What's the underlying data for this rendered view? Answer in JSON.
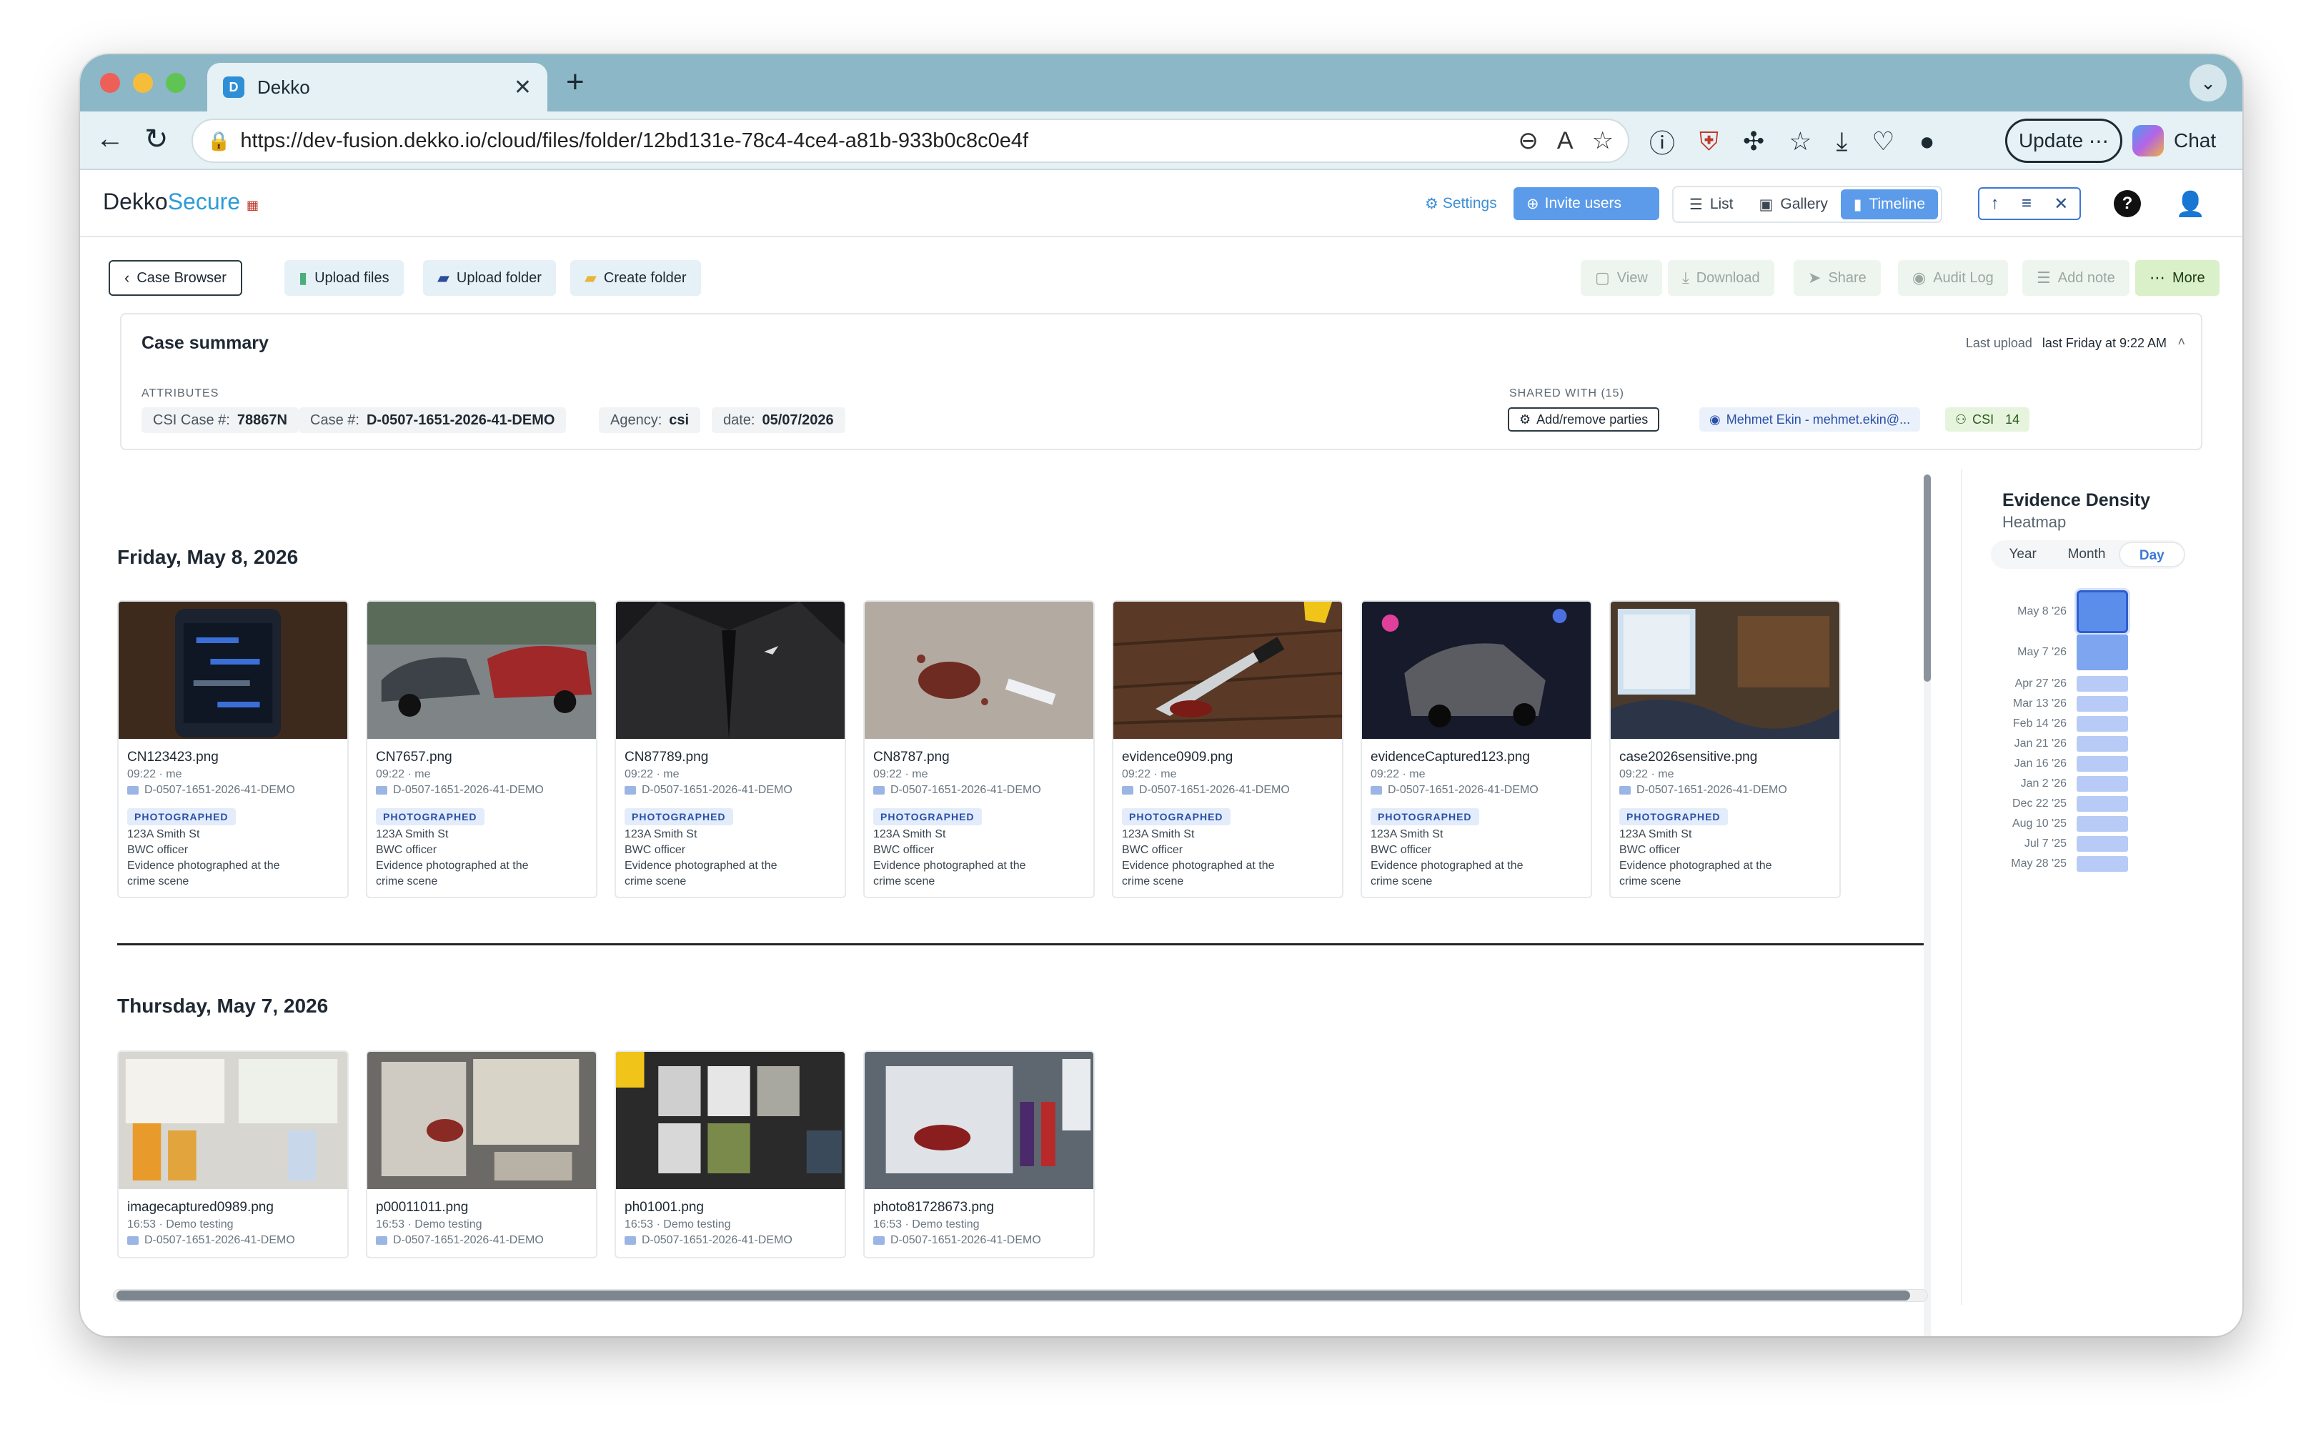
{
  "browser": {
    "tab_title": "Dekko",
    "tab_favicon_letter": "D",
    "url": "https://dev-fusion.dekko.io/cloud/files/folder/12bd131e-78c4-4ce4-a81b-933b0c8c0e4f",
    "update_label": "Update",
    "chat_label": "Chat"
  },
  "app": {
    "logo_a": "Dekko",
    "logo_b": "Secure",
    "settings_label": "Settings",
    "invite_label": "Invite users",
    "views": [
      "List",
      "Gallery",
      "Timeline"
    ],
    "active_view": "Timeline"
  },
  "toolbar": {
    "case_browser": "Case Browser",
    "upload_files": "Upload files",
    "upload_folder": "Upload folder",
    "create_folder": "Create folder",
    "view": "View",
    "download": "Download",
    "share": "Share",
    "audit_log": "Audit Log",
    "add_note": "Add note",
    "more": "More"
  },
  "case_summary": {
    "title": "Case summary",
    "last_upload_label": "Last upload",
    "last_upload_value": "last Friday at 9:22 AM",
    "attributes_label": "ATTRIBUTES",
    "attributes": [
      {
        "key": "CSI Case #:",
        "value": "78867N"
      },
      {
        "key": "Case #:",
        "value": "D-0507-1651-2026-41-DEMO"
      },
      {
        "key": "Agency:",
        "value": "csi"
      },
      {
        "key": "date:",
        "value": "05/07/2026"
      }
    ],
    "shared_label": "SHARED WITH (15)",
    "add_parties": "Add/remove parties",
    "shared_user": "Mehmet Ekin - mehmet.ekin@...",
    "group_name": "CSI",
    "group_count": "14"
  },
  "groups": [
    {
      "date": "Friday, May 8, 2026",
      "items": [
        {
          "name": "CN123423.png",
          "meta": "09:22 · me",
          "path": "D-0507-1651-2026-41-DEMO",
          "badge": "PHOTOGRAPHED",
          "line1": "123A Smith St",
          "line2": "BWC officer",
          "line3": "Evidence photographed at the",
          "line4": "crime scene"
        },
        {
          "name": "CN7657.png",
          "meta": "09:22 · me",
          "path": "D-0507-1651-2026-41-DEMO",
          "badge": "PHOTOGRAPHED",
          "line1": "123A Smith St",
          "line2": "BWC officer",
          "line3": "Evidence photographed at the",
          "line4": "crime scene"
        },
        {
          "name": "CN87789.png",
          "meta": "09:22 · me",
          "path": "D-0507-1651-2026-41-DEMO",
          "badge": "PHOTOGRAPHED",
          "line1": "123A Smith St",
          "line2": "BWC officer",
          "line3": "Evidence photographed at the",
          "line4": "crime scene"
        },
        {
          "name": "CN8787.png",
          "meta": "09:22 · me",
          "path": "D-0507-1651-2026-41-DEMO",
          "badge": "PHOTOGRAPHED",
          "line1": "123A Smith St",
          "line2": "BWC officer",
          "line3": "Evidence photographed at the",
          "line4": "crime scene"
        },
        {
          "name": "evidence0909.png",
          "meta": "09:22 · me",
          "path": "D-0507-1651-2026-41-DEMO",
          "badge": "PHOTOGRAPHED",
          "line1": "123A Smith St",
          "line2": "BWC officer",
          "line3": "Evidence photographed at the",
          "line4": "crime scene"
        },
        {
          "name": "evidenceCaptured123.png",
          "meta": "09:22 · me",
          "path": "D-0507-1651-2026-41-DEMO",
          "badge": "PHOTOGRAPHED",
          "line1": "123A Smith St",
          "line2": "BWC officer",
          "line3": "Evidence photographed at the",
          "line4": "crime scene"
        },
        {
          "name": "case2026sensitive.png",
          "meta": "09:22 · me",
          "path": "D-0507-1651-2026-41-DEMO",
          "badge": "PHOTOGRAPHED",
          "line1": "123A Smith St",
          "line2": "BWC officer",
          "line3": "Evidence photographed at the",
          "line4": "crime scene"
        }
      ]
    },
    {
      "date": "Thursday, May 7, 2026",
      "items": [
        {
          "name": "imagecaptured0989.png",
          "meta": "16:53 · Demo testing",
          "path": "D-0507-1651-2026-41-DEMO"
        },
        {
          "name": "p00011011.png",
          "meta": "16:53 · Demo testing",
          "path": "D-0507-1651-2026-41-DEMO"
        },
        {
          "name": "ph01001.png",
          "meta": "16:53 · Demo testing",
          "path": "D-0507-1651-2026-41-DEMO"
        },
        {
          "name": "photo81728673.png",
          "meta": "16:53 · Demo testing",
          "path": "D-0507-1651-2026-41-DEMO"
        }
      ]
    }
  ],
  "heatmap": {
    "title": "Evidence Density",
    "subtitle": "Heatmap",
    "tabs": [
      "Year",
      "Month",
      "Day"
    ],
    "active_tab": "Day",
    "rows": [
      "May 8 '26",
      "May 7 '26",
      "Apr 27 '26",
      "Mar 13 '26",
      "Feb 14 '26",
      "Jan 21 '26",
      "Jan 16 '26",
      "Jan 2 '26",
      "Dec 22 '25",
      "Aug 10 '25",
      "Jul 7 '25",
      "May 28 '25"
    ]
  },
  "colors": {
    "accent": "#5b9bea",
    "tabbar": "#8cb7c6",
    "heat_high": "#5b8eea",
    "heat_low": "#b8cbf6"
  }
}
